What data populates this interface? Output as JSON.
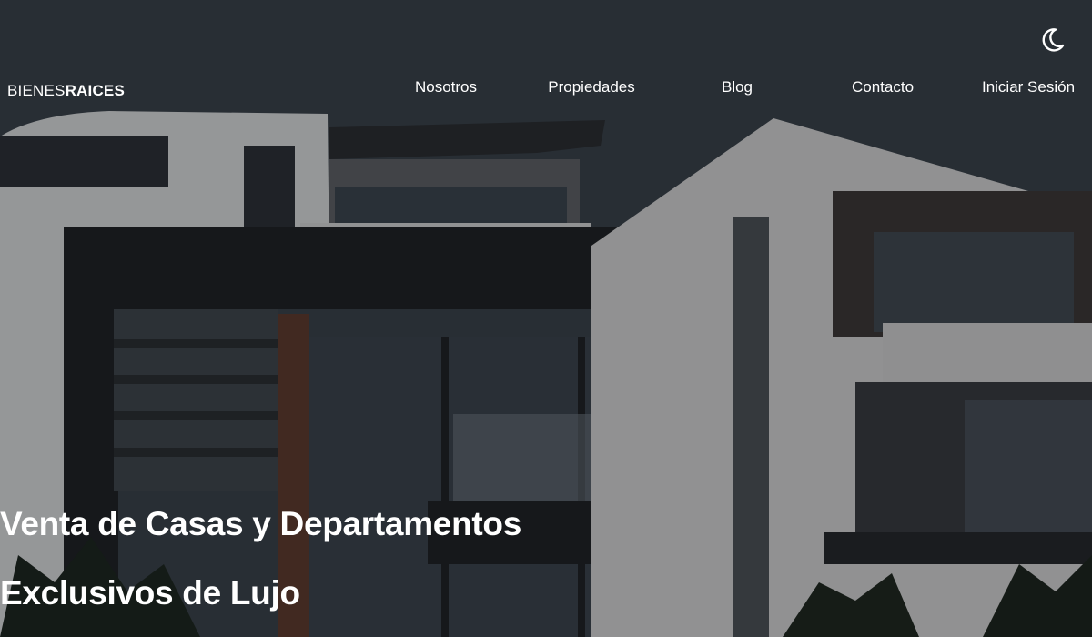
{
  "header": {
    "logo": {
      "light": "BIENES",
      "bold": "RAICES"
    },
    "theme_toggle_icon": "moon-icon",
    "nav": [
      {
        "label": "Nosotros"
      },
      {
        "label": "Propiedades"
      },
      {
        "label": "Blog"
      },
      {
        "label": "Contacto"
      },
      {
        "label": "Iniciar Sesión"
      }
    ]
  },
  "hero": {
    "background_image": "modern-house-photo",
    "headline_line1": "Venta de Casas y Departamentos",
    "headline_line2": "Exclusivos de Lujo"
  },
  "colors": {
    "text": "#ffffff",
    "overlay": "#000000"
  }
}
